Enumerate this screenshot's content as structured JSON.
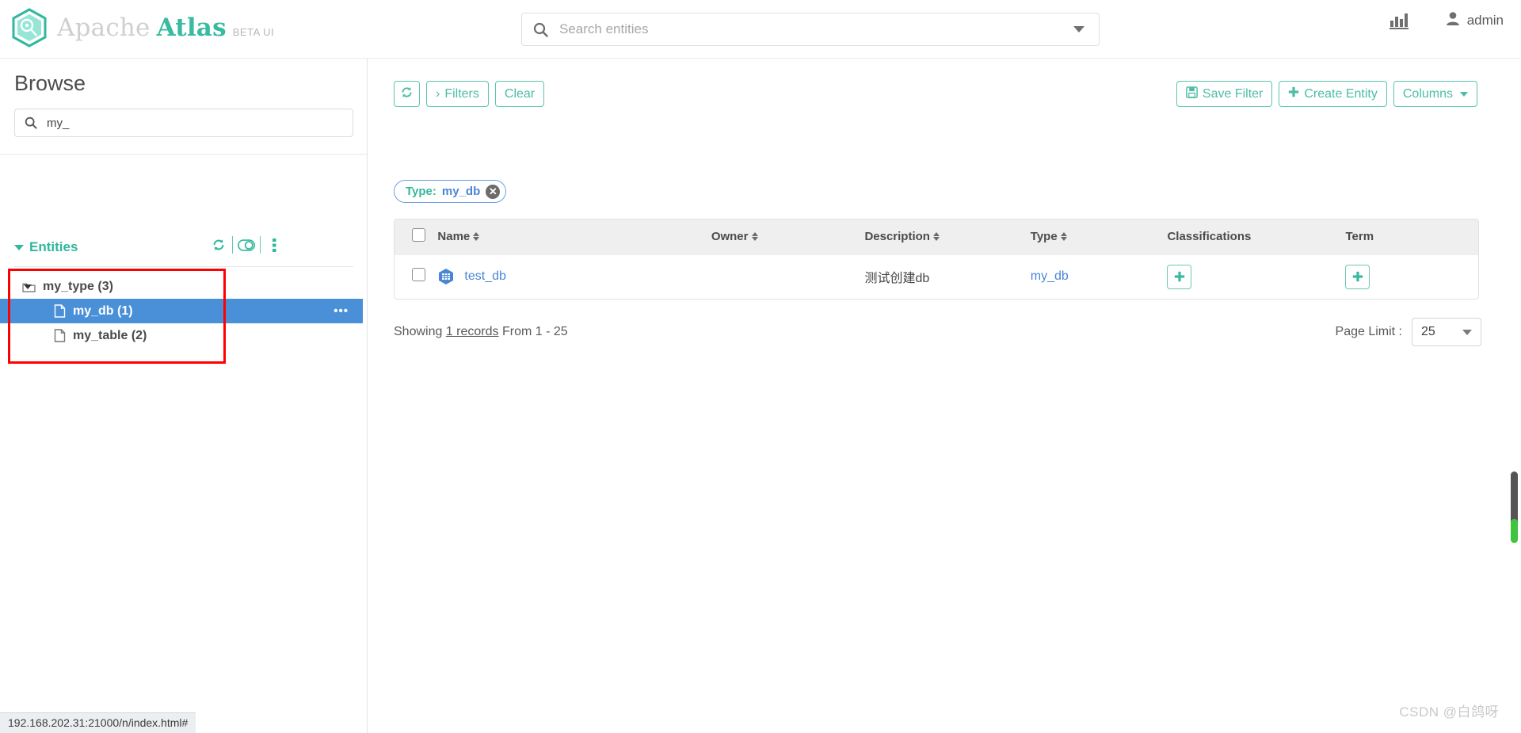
{
  "header": {
    "brand_apache": "Apache",
    "brand_atlas": "Atlas",
    "brand_beta": "BETA UI",
    "logo_icon": "atlas-hexagon-logo",
    "search": {
      "placeholder": "Search entities",
      "value": "",
      "icon": "search-icon",
      "dropdown_icon": "chevron-down-icon"
    },
    "stats_icon": "bar-chart-icon",
    "user_icon": "user-icon",
    "user_name": "admin"
  },
  "sidebar": {
    "title": "Browse",
    "search": {
      "value": "my_",
      "placeholder": "Search",
      "icon": "search-icon"
    },
    "entities_section": {
      "label": "Entities",
      "collapse_icon": "chevron-down-icon",
      "actions": [
        {
          "name": "refresh-icon",
          "label": ""
        },
        {
          "name": "toggle-icon",
          "label": ""
        },
        {
          "name": "more-vertical-icon",
          "label": ""
        }
      ]
    },
    "tree": [
      {
        "label": "my_type (3)",
        "level": 0,
        "icon": "folder-icon",
        "expanded": true,
        "selected": false,
        "caret_icon": "caret-down-icon"
      },
      {
        "label": "my_db (1)",
        "level": 1,
        "icon": "file-icon",
        "expanded": false,
        "selected": true,
        "row_menu_icon": "ellipsis-icon"
      },
      {
        "label": "my_table (2)",
        "level": 1,
        "icon": "file-icon",
        "expanded": false,
        "selected": false
      }
    ]
  },
  "toolbar": {
    "refresh_label": "",
    "refresh_icon": "refresh-icon",
    "filters_label": "Filters",
    "filters_icon": "chevron-right-icon",
    "clear_label": "Clear",
    "save_filter_label": "Save Filter",
    "save_filter_icon": "floppy-disk-icon",
    "create_entity_label": "Create Entity",
    "create_entity_icon": "plus-icon",
    "columns_label": "Columns",
    "columns_icon": "caret-down-icon"
  },
  "filter_chip": {
    "key": "Type:",
    "value": "my_db",
    "remove_icon": "close-circle-icon"
  },
  "table": {
    "select_all_checkbox": false,
    "columns": [
      {
        "label": "Name",
        "sortable": true
      },
      {
        "label": "Owner",
        "sortable": true
      },
      {
        "label": "Description",
        "sortable": true
      },
      {
        "label": "Type",
        "sortable": true
      },
      {
        "label": "Classifications",
        "sortable": false
      },
      {
        "label": "Term",
        "sortable": false
      }
    ],
    "rows": [
      {
        "checkbox": false,
        "entity_icon": "table-entity-icon",
        "name": "test_db",
        "owner": "",
        "description": "测试创建db",
        "type": "my_db",
        "classification_add_label": "+",
        "term_add_label": "+"
      }
    ]
  },
  "results_footer": {
    "showing_prefix": "Showing ",
    "records_count": "1 records",
    "showing_suffix": " From 1 - 25",
    "page_limit_label": "Page Limit :",
    "page_limit_value": "25",
    "page_limit_caret": "caret-down-icon"
  },
  "statusbar": {
    "url": "192.168.202.31:21000/n/index.html#"
  },
  "watermark": {
    "text": "CSDN @白鸽呀"
  },
  "colors": {
    "accent_teal": "#38bba1",
    "link_blue": "#4a86d6",
    "selected_row": "#4a90d9",
    "annotation_red": "#ff0000",
    "header_bg": "#efefef"
  }
}
